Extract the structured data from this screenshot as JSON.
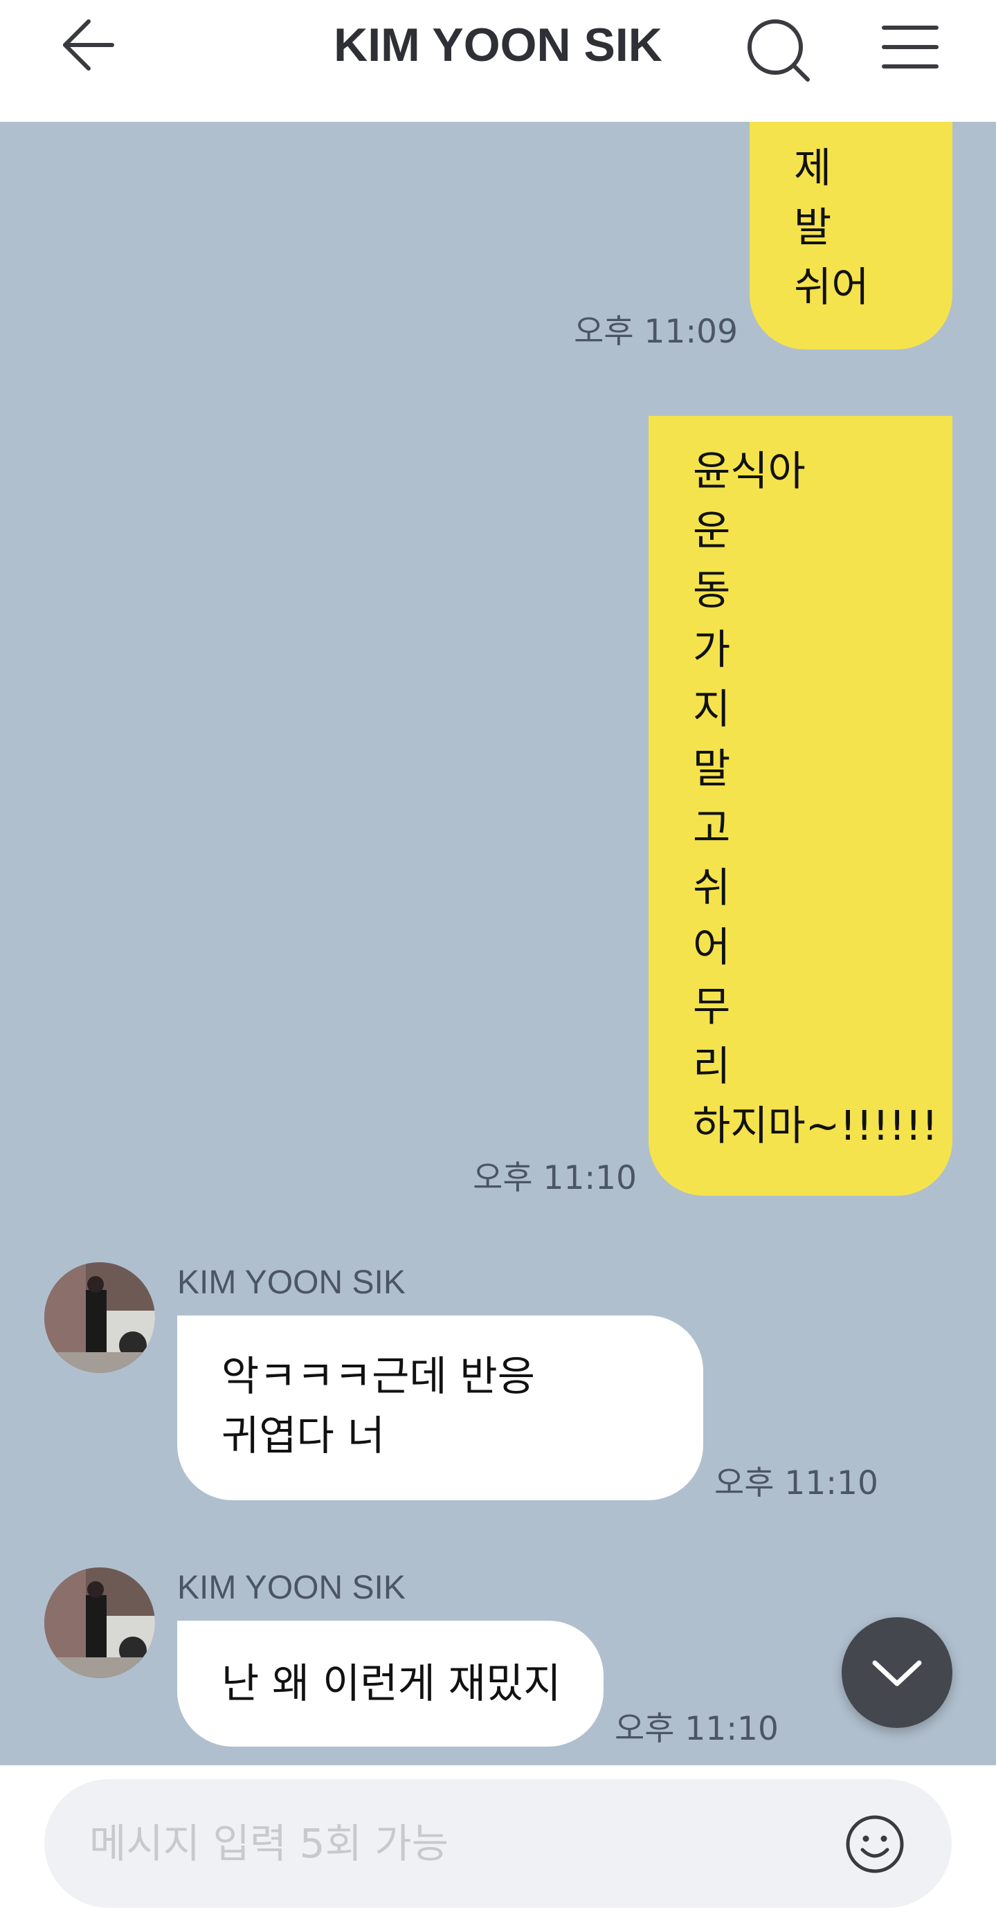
{
  "header": {
    "title": "KIM YOON SIK",
    "back_icon": "arrow-left-icon",
    "search_icon": "search-icon",
    "menu_icon": "hamburger-menu-icon"
  },
  "messages": [
    {
      "from": "me",
      "text": "제\n발\n쉬어",
      "time": "오후 11:09"
    },
    {
      "from": "me",
      "text": "윤식아\n운\n동\n가\n지\n말\n고\n쉬\n어\n무\n리\n하지마~!!!!!!",
      "time": "오후 11:10"
    },
    {
      "from": "them",
      "sender": "KIM YOON SIK",
      "text": "악ㅋㅋㅋ근데 반응\n귀엽다 너",
      "time": "오후 11:10"
    },
    {
      "from": "them",
      "sender": "KIM YOON SIK",
      "text": "난 왜 이런게 재밌지",
      "time": "오후 11:10"
    }
  ],
  "scroll_down_icon": "chevron-down-icon",
  "input": {
    "placeholder": "메시지 입력 5회 가능",
    "emoji_icon": "smiley-icon"
  },
  "colors": {
    "background": "#b0bfce",
    "my_bubble": "#f4e34c",
    "their_bubble": "#ffffff",
    "header": "#ffffff"
  }
}
